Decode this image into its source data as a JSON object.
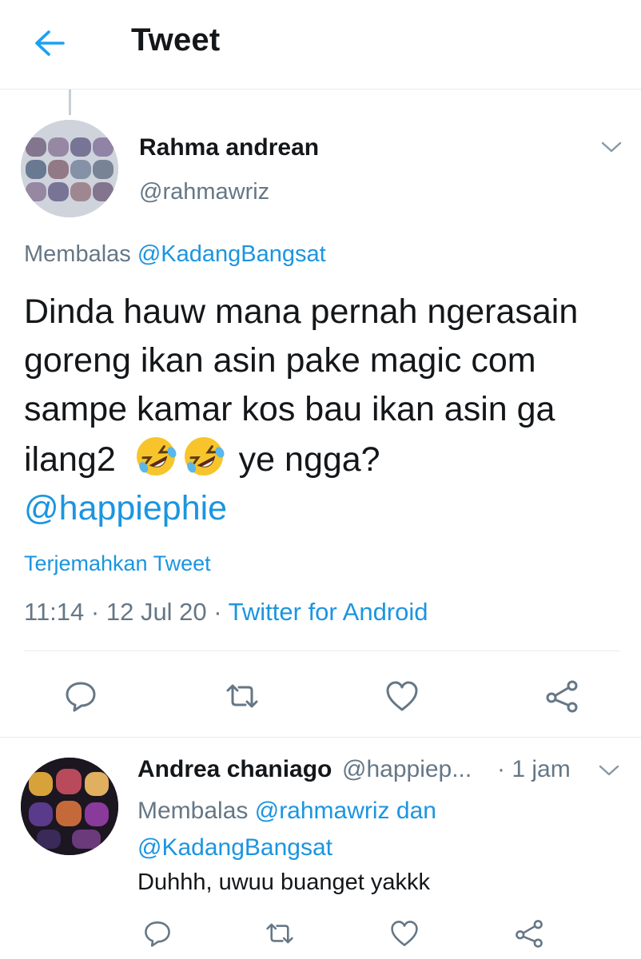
{
  "header": {
    "title": "Tweet",
    "back_icon": "arrow-left-icon",
    "accent": "#1da1f2"
  },
  "tweet": {
    "author_name": "Rahma andrean",
    "author_handle": "@rahmawriz",
    "replying_prefix": "Membalas",
    "replying_to": "@KadangBangsat",
    "text_main": "Dinda hauw mana pernah ngerasain goreng ikan asin pake magic com sampe kamar kos bau ikan asin ga ilang2",
    "emojis": [
      "rolling-on-floor-laughing-emoji",
      "rolling-on-floor-laughing-emoji"
    ],
    "text_tail": " ye ngga?",
    "mention": "@happiephie",
    "translate_label": "Terjemahkan Tweet",
    "time": "11:14",
    "date": "12 Jul 20",
    "separator": " · ",
    "client": "Twitter for Android",
    "actions": [
      "reply-icon",
      "retweet-icon",
      "like-icon",
      "share-icon"
    ]
  },
  "reply": {
    "author_name": "Andrea chaniago",
    "author_handle": "@happiep...",
    "time": "· 1 jam",
    "replying_prefix": "Membalas",
    "replying_to_1": "@rahmawriz",
    "conjunction": "dan",
    "replying_to_2": "@KadangBangsat",
    "text": "Duhhh,  uwuu buanget yakkk",
    "actions": [
      "reply-icon",
      "retweet-icon",
      "like-icon",
      "share-icon"
    ]
  },
  "colors": {
    "text": "#14171a",
    "secondary": "#657786",
    "link": "#1b95e0",
    "divider": "#e6ecf0"
  }
}
